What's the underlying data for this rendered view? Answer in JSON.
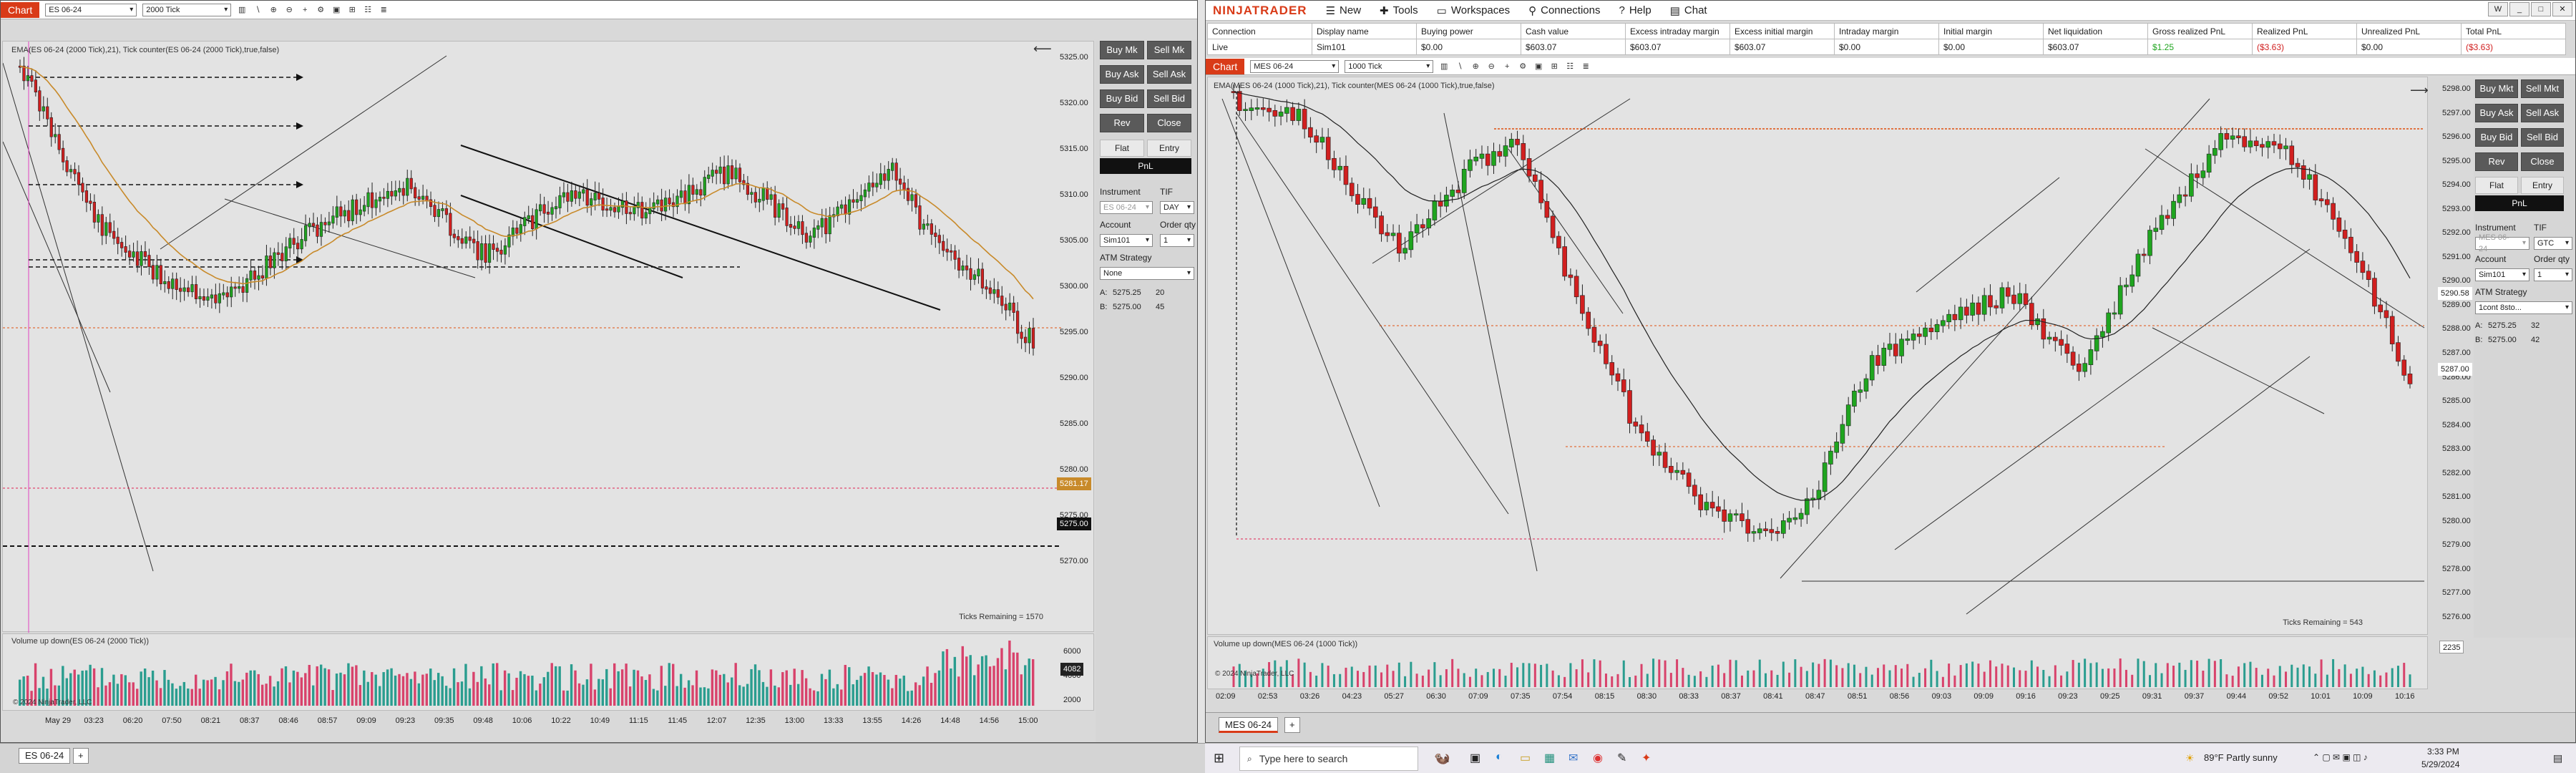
{
  "left_window": {
    "tag": "Chart",
    "instrument": "ES 06-24",
    "interval": "2000 Tick",
    "indicator_label": "EMA(ES 06-24 (2000 Tick),21), Tick counter(ES 06-24 (2000 Tick),true,false)",
    "price_labels": [
      "5325.00",
      "5320.00",
      "5315.00",
      "5310.00",
      "5305.00",
      "5300.00",
      "5295.00",
      "5290.00",
      "5285.00",
      "5280.00",
      "5275.00",
      "5270.00"
    ],
    "current_price": "5275.00",
    "ema_label": "5281.17",
    "time_labels": [
      "May 29",
      "03:23",
      "06:20",
      "07:50",
      "08:21",
      "08:37",
      "08:46",
      "08:57",
      "09:09",
      "09:23",
      "09:35",
      "09:48",
      "10:06",
      "10:22",
      "10:49",
      "11:15",
      "11:45",
      "12:07",
      "12:35",
      "13:00",
      "13:33",
      "13:55",
      "14:26",
      "14:48",
      "14:56",
      "15:00"
    ],
    "ticks_remaining": "Ticks Remaining = 1570",
    "volume_label": "Volume up down(ES 06-24 (2000 Tick))",
    "volume_axis": [
      "6000",
      "4000",
      "2000"
    ],
    "volume_current": "4082",
    "copyright": "© 2024 NinjaTrader, LLC",
    "tab_label": "ES 06-24",
    "panel": {
      "buy_mkt": "Buy Mk",
      "sell_mkt": "Sell Mk",
      "buy_ask": "Buy Ask",
      "sell_ask": "Sell Ask",
      "buy_bid": "Buy Bid",
      "sell_bid": "Sell Bid",
      "rev": "Rev",
      "close": "Close",
      "flat": "Flat",
      "entry": "Entry",
      "pnl": "PnL",
      "instrument_label": "Instrument",
      "tif_label": "TIF",
      "instrument_value": "ES 06-24",
      "tif_value": "DAY",
      "account_label": "Account",
      "order_qty_label": "Order qty",
      "account_value": "Sim101",
      "qty_value": "1",
      "atm_label": "ATM Strategy",
      "atm_value": "None",
      "ask_label": "A:",
      "ask_price": "5275.25",
      "ask_size": "20",
      "bid_label": "B:",
      "bid_price": "5275.00",
      "bid_size": "45"
    }
  },
  "right_window": {
    "logo": "NINJATRADER",
    "menu": [
      "New",
      "Tools",
      "Workspaces",
      "Connections",
      "Help",
      "Chat"
    ],
    "account_table": {
      "headers": [
        "Connection",
        "Display name",
        "Buying power",
        "Cash value",
        "Excess intraday margin",
        "Excess initial margin",
        "Intraday margin",
        "Initial margin",
        "Net liquidation",
        "Gross realized PnL",
        "Realized PnL",
        "Unrealized PnL",
        "Total PnL"
      ],
      "row": [
        "Live",
        "Sim101",
        "$0.00",
        "$603.07",
        "$603.07",
        "$603.07",
        "$0.00",
        "$0.00",
        "$603.07",
        "$1.25",
        "($3.63)",
        "$0.00",
        "($3.63)"
      ]
    },
    "tag": "Chart",
    "instrument": "MES 06-24",
    "interval": "1000 Tick",
    "indicator_label": "EMA(MES 06-24 (1000 Tick),21), Tick counter(MES 06-24 (1000 Tick),true,false)",
    "price_labels": [
      "5298.00",
      "5297.00",
      "5296.00",
      "5295.00",
      "5294.00",
      "5293.00",
      "5292.00",
      "5291.00",
      "5290.00",
      "5289.00",
      "5288.00",
      "5287.00",
      "5286.00",
      "5285.00",
      "5284.00",
      "5283.00",
      "5282.00",
      "5281.00",
      "5280.00",
      "5279.00",
      "5278.00",
      "5277.00",
      "5276.00"
    ],
    "current_price": "5287.00",
    "ema_label": "5290.58",
    "time_labels": [
      "02:09",
      "02:53",
      "03:26",
      "04:23",
      "05:27",
      "06:30",
      "07:09",
      "07:35",
      "07:54",
      "08:15",
      "08:30",
      "08:33",
      "08:37",
      "08:41",
      "08:47",
      "08:51",
      "08:56",
      "09:03",
      "09:09",
      "09:16",
      "09:23",
      "09:25",
      "09:31",
      "09:37",
      "09:44",
      "09:52",
      "10:01",
      "10:09",
      "10:16"
    ],
    "ticks_remaining": "Ticks Remaining = 543",
    "volume_label": "Volume up down(MES 06-24 (1000 Tick))",
    "volume_current": "2235",
    "copyright": "© 2024 NinjaTrader, LLC",
    "tab_label": "MES 06-24",
    "panel": {
      "buy_mkt": "Buy Mkt",
      "sell_mkt": "Sell Mkt",
      "buy_ask": "Buy Ask",
      "sell_ask": "Sell Ask",
      "buy_bid": "Buy Bid",
      "sell_bid": "Sell Bid",
      "rev": "Rev",
      "close": "Close",
      "flat": "Flat",
      "entry": "Entry",
      "pnl": "PnL",
      "instrument_label": "Instrument",
      "tif_label": "TIF",
      "instrument_value": "MES 06-24",
      "tif_value": "GTC",
      "account_label": "Account",
      "order_qty_label": "Order qty",
      "account_value": "Sim101",
      "qty_value": "1",
      "atm_label": "ATM Strategy",
      "atm_value": "1cont 8sto...",
      "ask_label": "A:",
      "ask_price": "5275.25",
      "ask_size": "32",
      "bid_label": "B:",
      "bid_price": "5275.00",
      "bid_size": "42"
    }
  },
  "taskbar": {
    "search_placeholder": "Type here to search",
    "weather": "89°F  Partly sunny",
    "time": "3:33 PM",
    "date": "5/29/2024"
  },
  "colors": {
    "up": "#1fa51f",
    "down": "#d11f1f",
    "brand": "#d93b18",
    "vol_up": "#2a9d8f",
    "vol_down": "#d8426b"
  }
}
